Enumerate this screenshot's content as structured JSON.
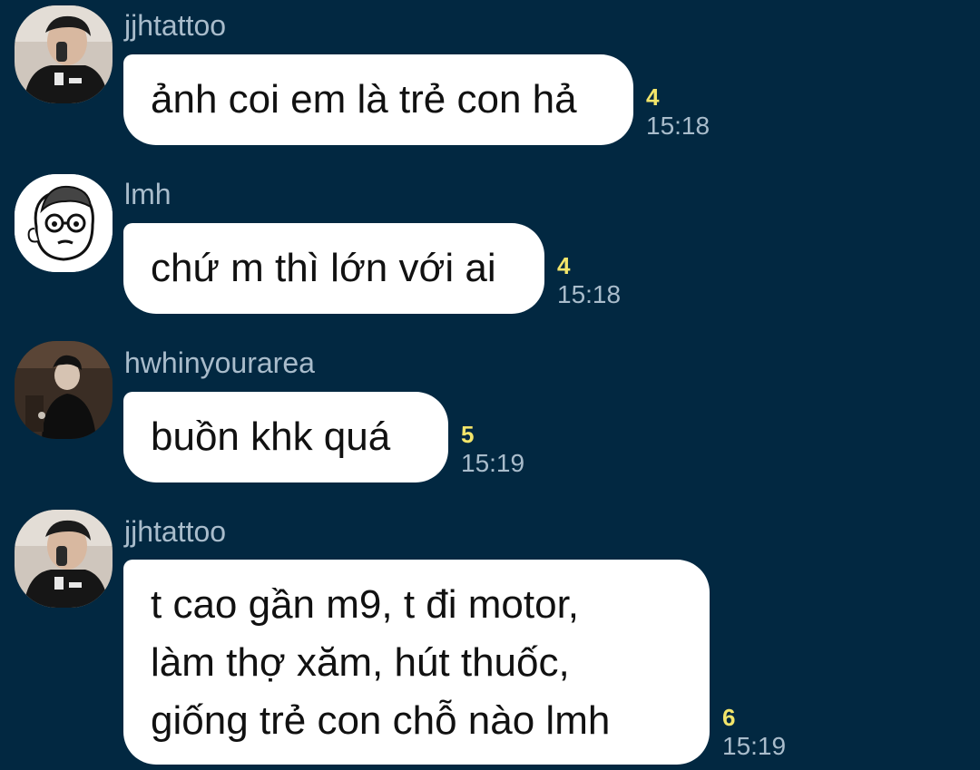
{
  "messages": [
    {
      "sender": "jjhtattoo",
      "avatar_icon": "profile-photo-icon",
      "lines": [
        "ảnh coi em là trẻ con hả"
      ],
      "unread_count": "4",
      "time": "15:18"
    },
    {
      "sender": "lmh",
      "avatar_icon": "cartoon-face-icon",
      "lines": [
        "chứ m thì lớn với ai"
      ],
      "unread_count": "4",
      "time": "15:18"
    },
    {
      "sender": "hwhinyourarea",
      "avatar_icon": "profile-photo-icon",
      "lines": [
        "buồn khk quá"
      ],
      "unread_count": "5",
      "time": "15:19"
    },
    {
      "sender": "jjhtattoo",
      "avatar_icon": "profile-photo-icon",
      "lines": [
        "t cao gần m9, t đi motor,",
        "làm thợ xăm, hút thuốc,",
        "giống trẻ con chỗ nào lmh"
      ],
      "unread_count": "6",
      "time": "15:19"
    }
  ],
  "colors": {
    "background": "#022841",
    "bubble": "#ffffff",
    "unread_count": "#f3e56a",
    "meta_text": "#a9bccb"
  }
}
